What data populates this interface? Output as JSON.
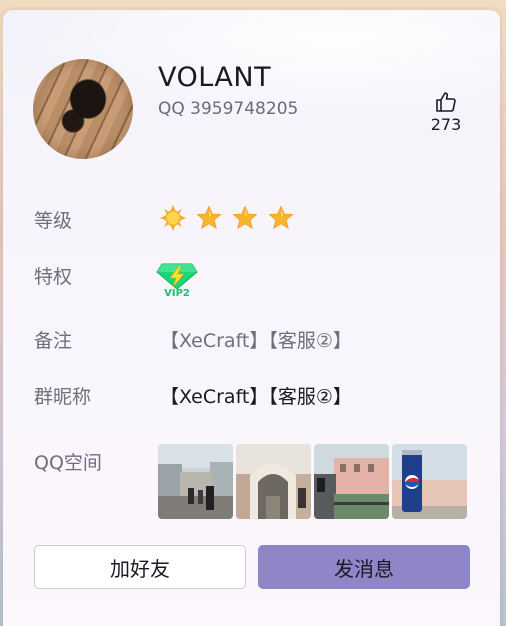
{
  "profile": {
    "nickname": "VOLANT",
    "qq": "QQ 3959748205",
    "likes": "273"
  },
  "labels": {
    "level": "等级",
    "privilege": "特权",
    "remark": "备注",
    "group_nick": "群昵称",
    "qzone": "QQ空间"
  },
  "level": {
    "icons": [
      "sun-icon",
      "star-icon",
      "star-icon",
      "star-icon"
    ]
  },
  "privilege": {
    "badge": "svip-badge-icon",
    "badge_text": "VIP2"
  },
  "remark": "【XeCraft】【客服②】",
  "group_nick": "【XeCraft】【客服②】",
  "qzone_photos": [
    {
      "name": "qzone-photo-1",
      "desc": "street"
    },
    {
      "name": "qzone-photo-2",
      "desc": "arch"
    },
    {
      "name": "qzone-photo-3",
      "desc": "plaza"
    },
    {
      "name": "qzone-photo-4",
      "desc": "can"
    }
  ],
  "buttons": {
    "add_friend": "加好友",
    "send_message": "发消息"
  },
  "colors": {
    "accent": "#8e86c6",
    "label": "#6f6e7d",
    "star": "#f7b52a"
  }
}
